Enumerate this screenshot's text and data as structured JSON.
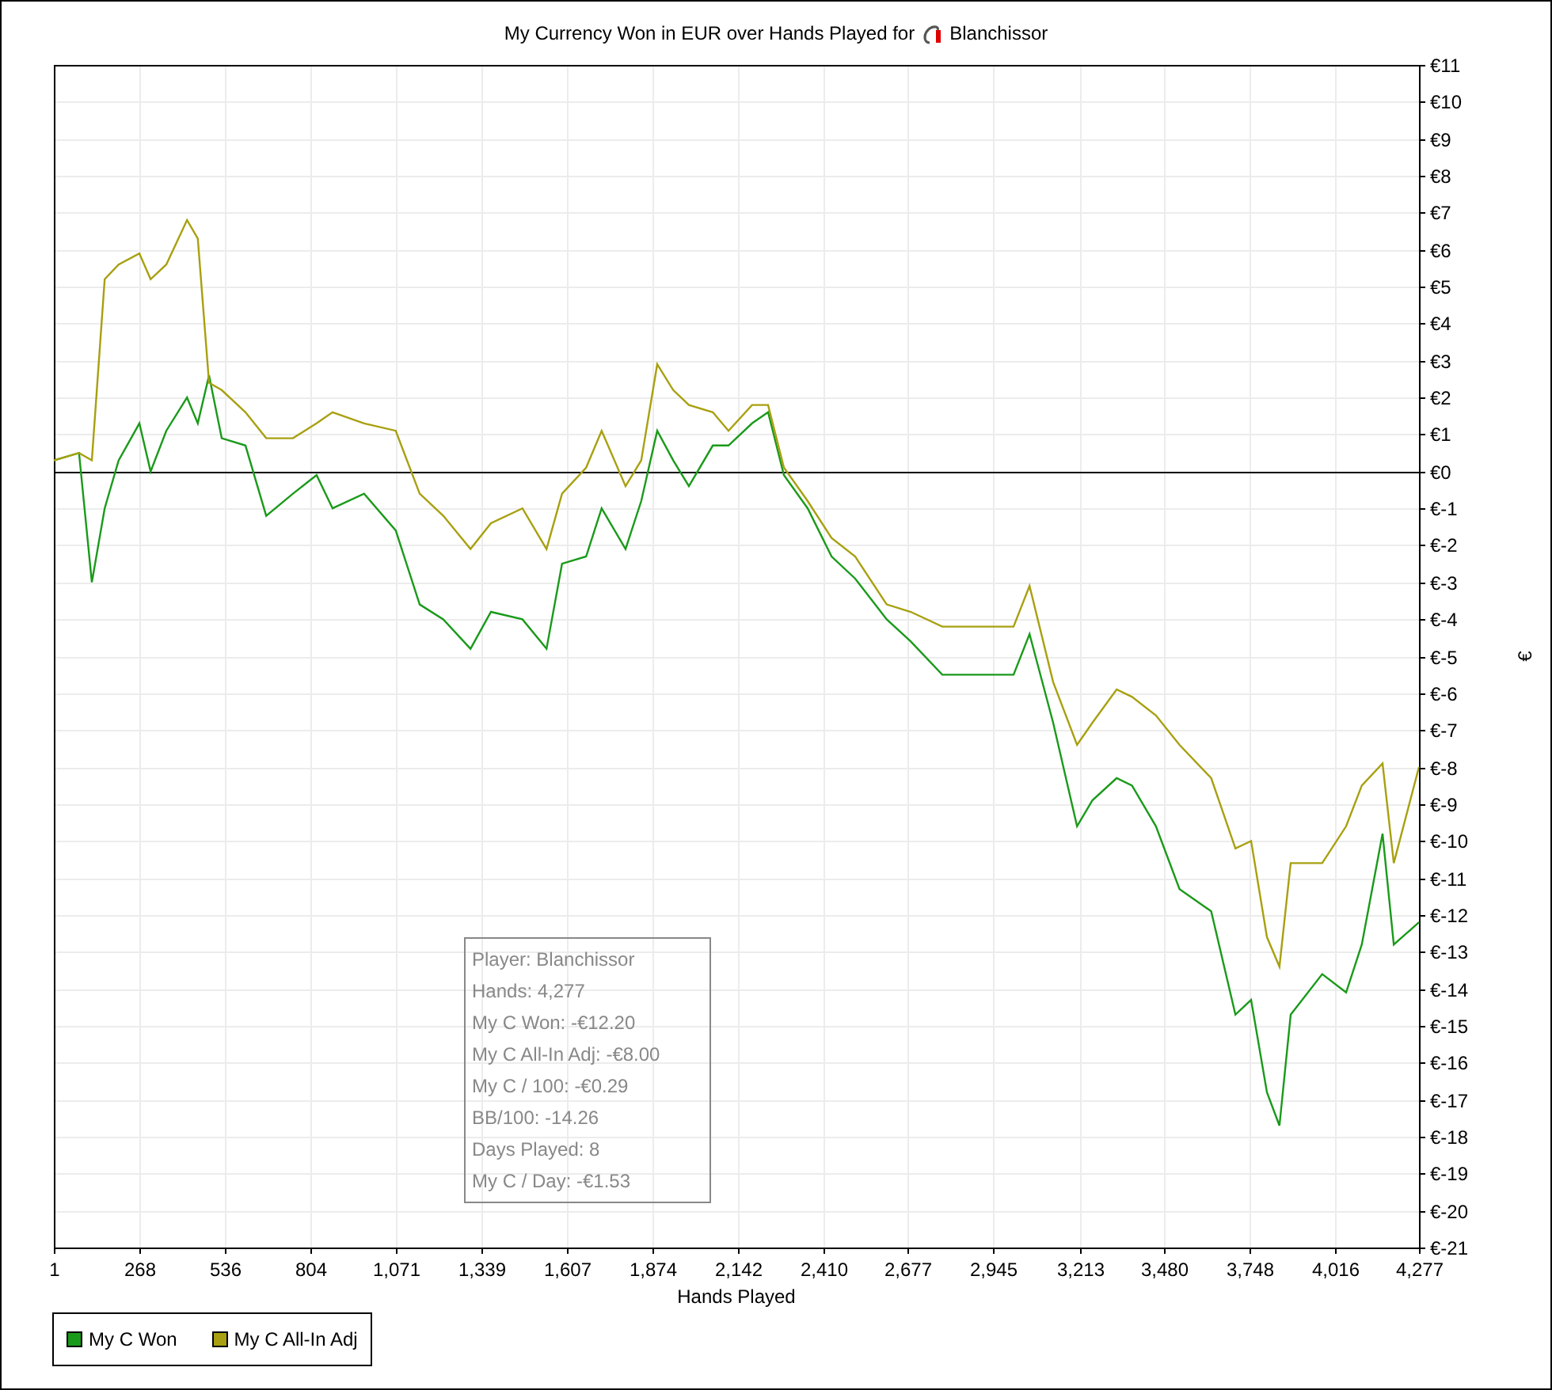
{
  "title": "My Currency Won in EUR over Hands Played for",
  "player": "Blanchissor",
  "chart_data": {
    "type": "line",
    "xlabel": "Hands Played",
    "ylabel": "€",
    "x": [
      1,
      80,
      120,
      160,
      204,
      269,
      304,
      353,
      418,
      452,
      487,
      527,
      601,
      666,
      750,
      824,
      874,
      973,
      1072,
      1147,
      1221,
      1306,
      1370,
      1469,
      1544,
      1593,
      1668,
      1717,
      1792,
      1841,
      1891,
      1941,
      1990,
      2065,
      2114,
      2188,
      2238,
      2288,
      2362,
      2437,
      2511,
      2610,
      2685,
      2784,
      2908,
      3007,
      3057,
      3131,
      3206,
      3254,
      3330,
      3378,
      3453,
      3527,
      3626,
      3702,
      3751,
      3801,
      3840,
      3875,
      3974,
      4049,
      4098,
      4163,
      4198,
      4277
    ],
    "series": [
      {
        "name": "My C Won",
        "color": "#1a9a1a",
        "values": [
          0.3,
          0.5,
          -3.0,
          -1.0,
          0.3,
          1.3,
          0.0,
          1.1,
          2.0,
          1.3,
          2.6,
          0.9,
          0.7,
          -1.2,
          -0.6,
          -0.1,
          -1.0,
          -0.6,
          -1.6,
          -3.6,
          -4.0,
          -4.8,
          -3.8,
          -4.0,
          -4.8,
          -2.5,
          -2.3,
          -1.0,
          -2.1,
          -0.8,
          1.1,
          0.3,
          -0.4,
          0.7,
          0.7,
          1.3,
          1.6,
          -0.1,
          -1.0,
          -2.3,
          -2.9,
          -4.0,
          -4.6,
          -5.5,
          -5.5,
          -5.5,
          -4.4,
          -6.8,
          -9.6,
          -8.9,
          -8.3,
          -8.5,
          -9.6,
          -11.3,
          -11.9,
          -14.7,
          -14.3,
          -16.8,
          -17.7,
          -14.7,
          -13.6,
          -14.1,
          -12.8,
          -9.8,
          -12.8,
          -12.2
        ]
      },
      {
        "name": "My C All-In Adj",
        "color": "#a8a010",
        "values": [
          0.3,
          0.5,
          0.3,
          5.2,
          5.6,
          5.9,
          5.2,
          5.6,
          6.8,
          6.3,
          2.4,
          2.2,
          1.6,
          0.9,
          0.9,
          1.3,
          1.6,
          1.3,
          1.1,
          -0.6,
          -1.2,
          -2.1,
          -1.4,
          -1.0,
          -2.1,
          -0.6,
          0.1,
          1.1,
          -0.4,
          0.3,
          2.9,
          2.2,
          1.8,
          1.6,
          1.1,
          1.8,
          1.8,
          0.1,
          -0.8,
          -1.8,
          -2.3,
          -3.6,
          -3.8,
          -4.2,
          -4.2,
          -4.2,
          -3.1,
          -5.7,
          -7.4,
          -6.8,
          -5.9,
          -6.1,
          -6.6,
          -7.4,
          -8.3,
          -10.2,
          -10.0,
          -12.6,
          -13.4,
          -10.6,
          -10.6,
          -9.6,
          -8.5,
          -7.9,
          -10.6,
          -8.0
        ]
      }
    ],
    "xlim": [
      1,
      4277
    ],
    "ylim": [
      -21,
      11
    ],
    "grid": true,
    "xticks": [
      {
        "value": 1,
        "label": "1"
      },
      {
        "value": 268,
        "label": "268"
      },
      {
        "value": 536,
        "label": "536"
      },
      {
        "value": 804,
        "label": "804"
      },
      {
        "value": 1071,
        "label": "1,071"
      },
      {
        "value": 1339,
        "label": "1,339"
      },
      {
        "value": 1607,
        "label": "1,607"
      },
      {
        "value": 1874,
        "label": "1,874"
      },
      {
        "value": 2142,
        "label": "2,142"
      },
      {
        "value": 2410,
        "label": "2,410"
      },
      {
        "value": 2677,
        "label": "2,677"
      },
      {
        "value": 2945,
        "label": "2,945"
      },
      {
        "value": 3213,
        "label": "3,213"
      },
      {
        "value": 3480,
        "label": "3,480"
      },
      {
        "value": 3748,
        "label": "3,748"
      },
      {
        "value": 4016,
        "label": "4,016"
      },
      {
        "value": 4277,
        "label": "4,277"
      }
    ],
    "yticks": [
      {
        "value": 11,
        "label": "€11"
      },
      {
        "value": 10,
        "label": "€10"
      },
      {
        "value": 9,
        "label": "€9"
      },
      {
        "value": 8,
        "label": "€8"
      },
      {
        "value": 7,
        "label": "€7"
      },
      {
        "value": 6,
        "label": "€6"
      },
      {
        "value": 5,
        "label": "€5"
      },
      {
        "value": 4,
        "label": "€4"
      },
      {
        "value": 3,
        "label": "€3"
      },
      {
        "value": 2,
        "label": "€2"
      },
      {
        "value": 1,
        "label": "€1"
      },
      {
        "value": 0,
        "label": "€0"
      },
      {
        "value": -1,
        "label": "€-1"
      },
      {
        "value": -2,
        "label": "€-2"
      },
      {
        "value": -3,
        "label": "€-3"
      },
      {
        "value": -4,
        "label": "€-4"
      },
      {
        "value": -5,
        "label": "€-5"
      },
      {
        "value": -6,
        "label": "€-6"
      },
      {
        "value": -7,
        "label": "€-7"
      },
      {
        "value": -8,
        "label": "€-8"
      },
      {
        "value": -9,
        "label": "€-9"
      },
      {
        "value": -10,
        "label": "€-10"
      },
      {
        "value": -11,
        "label": "€-11"
      },
      {
        "value": -12,
        "label": "€-12"
      },
      {
        "value": -13,
        "label": "€-13"
      },
      {
        "value": -14,
        "label": "€-14"
      },
      {
        "value": -15,
        "label": "€-15"
      },
      {
        "value": -16,
        "label": "€-16"
      },
      {
        "value": -17,
        "label": "€-17"
      },
      {
        "value": -18,
        "label": "€-18"
      },
      {
        "value": -19,
        "label": "€-19"
      },
      {
        "value": -20,
        "label": "€-20"
      },
      {
        "value": -21,
        "label": "€-21"
      }
    ]
  },
  "stats": [
    "Player: Blanchissor",
    "Hands: 4,277",
    "My C Won: -€12.20",
    "My C All-In Adj: -€8.00",
    "My C / 100: -€0.29",
    "BB/100: -14.26",
    "Days Played: 8",
    "My C / Day: -€1.53"
  ]
}
